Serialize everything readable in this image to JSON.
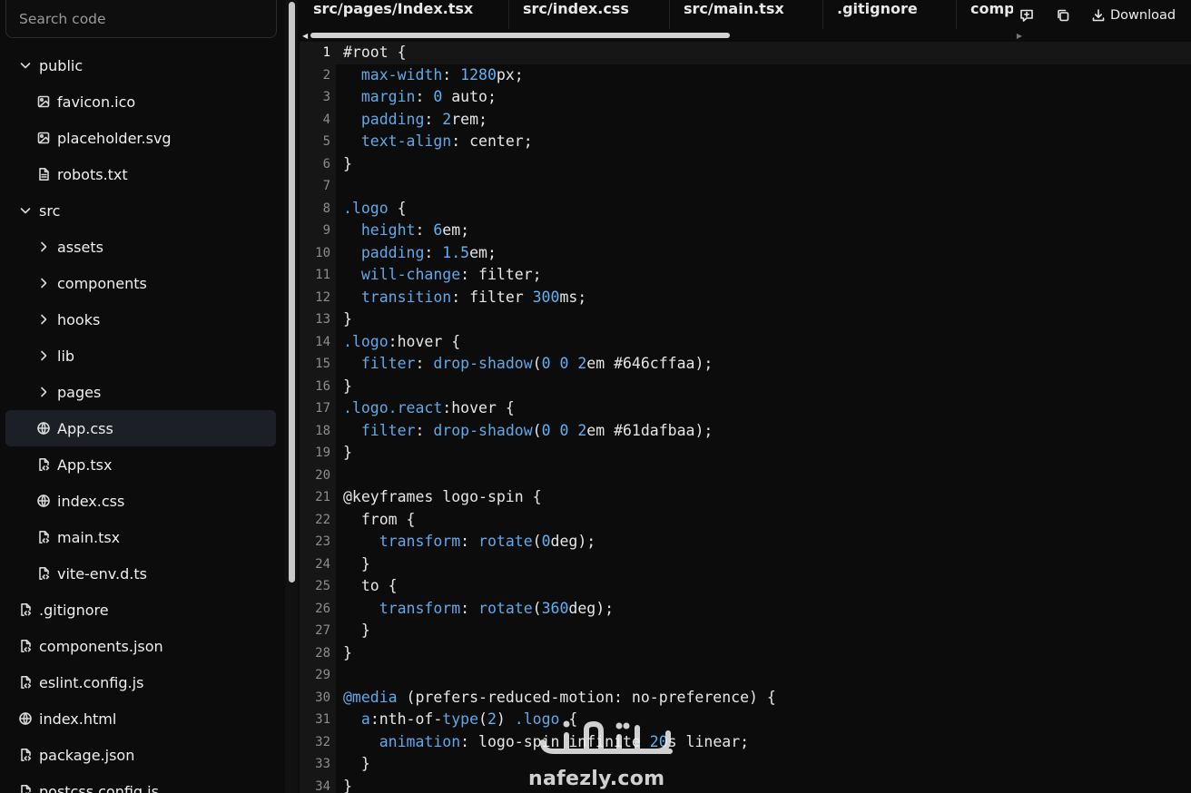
{
  "search": {
    "placeholder": "Search code"
  },
  "tree": [
    {
      "label": "public",
      "type": "folder-open",
      "depth": 0
    },
    {
      "label": "favicon.ico",
      "type": "image",
      "depth": 1
    },
    {
      "label": "placeholder.svg",
      "type": "image",
      "depth": 1
    },
    {
      "label": "robots.txt",
      "type": "file",
      "depth": 1
    },
    {
      "label": "src",
      "type": "folder-open",
      "depth": 0
    },
    {
      "label": "assets",
      "type": "folder-closed",
      "depth": 1
    },
    {
      "label": "components",
      "type": "folder-closed",
      "depth": 1
    },
    {
      "label": "hooks",
      "type": "folder-closed",
      "depth": 1
    },
    {
      "label": "lib",
      "type": "folder-closed",
      "depth": 1
    },
    {
      "label": "pages",
      "type": "folder-closed",
      "depth": 1
    },
    {
      "label": "App.css",
      "type": "globe",
      "depth": 1,
      "selected": true
    },
    {
      "label": "App.tsx",
      "type": "code-file",
      "depth": 1
    },
    {
      "label": "index.css",
      "type": "globe",
      "depth": 1
    },
    {
      "label": "main.tsx",
      "type": "code-file",
      "depth": 1
    },
    {
      "label": "vite-env.d.ts",
      "type": "code-file",
      "depth": 1
    },
    {
      "label": ".gitignore",
      "type": "code-file",
      "depth": 0
    },
    {
      "label": "components.json",
      "type": "code-file",
      "depth": 0
    },
    {
      "label": "eslint.config.js",
      "type": "code-file",
      "depth": 0
    },
    {
      "label": "index.html",
      "type": "globe",
      "depth": 0
    },
    {
      "label": "package.json",
      "type": "code-file",
      "depth": 0
    },
    {
      "label": "postcss.config.js",
      "type": "code-file",
      "depth": 0
    }
  ],
  "tabs": [
    {
      "label": "src/pages/Index.tsx"
    },
    {
      "label": "src/index.css"
    },
    {
      "label": "src/main.tsx"
    },
    {
      "label": ".gitignore"
    },
    {
      "label": "comp"
    }
  ],
  "actions": {
    "download_label": "Download"
  },
  "editor": {
    "active_line": 1,
    "lines": [
      "#root {",
      "  max-width: 1280px;",
      "  margin: 0 auto;",
      "  padding: 2rem;",
      "  text-align: center;",
      "}",
      "",
      ".logo {",
      "  height: 6em;",
      "  padding: 1.5em;",
      "  will-change: filter;",
      "  transition: filter 300ms;",
      "}",
      ".logo:hover {",
      "  filter: drop-shadow(0 0 2em #646cffaa);",
      "}",
      ".logo.react:hover {",
      "  filter: drop-shadow(0 0 2em #61dafbaa);",
      "}",
      "",
      "@keyframes logo-spin {",
      "  from {",
      "    transform: rotate(0deg);",
      "  }",
      "  to {",
      "    transform: rotate(360deg);",
      "  }",
      "}",
      "",
      "@media (prefers-reduced-motion: no-preference) {",
      "  a:nth-of-type(2) .logo {",
      "    animation: logo-spin infinite 20s linear;",
      "  }",
      "}"
    ]
  },
  "watermark": {
    "text": "nafezly.com"
  },
  "colors": {
    "keyword": "#62a8e8",
    "number": "#5fb3f5",
    "text": "#e6e6e6",
    "background": "#0c0c0c"
  }
}
